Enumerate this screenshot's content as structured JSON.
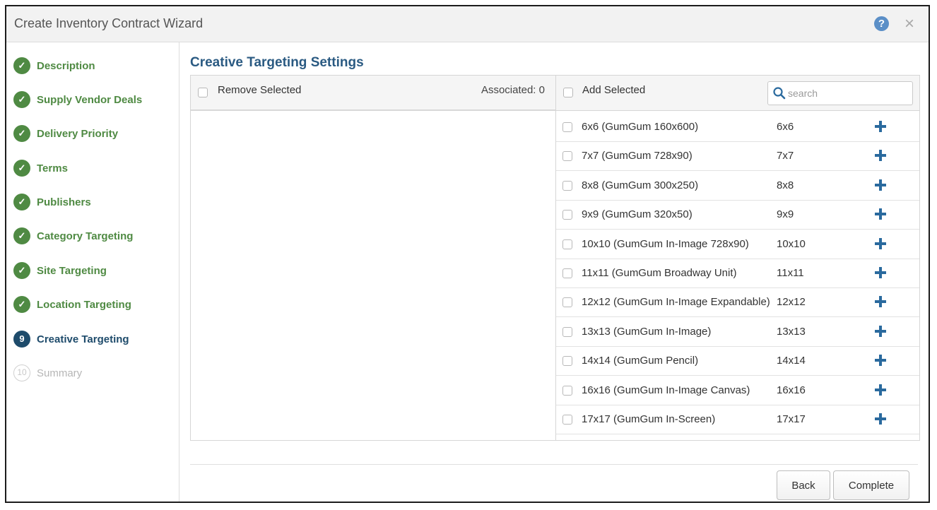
{
  "window": {
    "title": "Create Inventory Contract Wizard"
  },
  "steps": [
    {
      "label": "Description",
      "state": "done"
    },
    {
      "label": "Supply Vendor Deals",
      "state": "done"
    },
    {
      "label": "Delivery Priority",
      "state": "done"
    },
    {
      "label": "Terms",
      "state": "done"
    },
    {
      "label": "Publishers",
      "state": "done"
    },
    {
      "label": "Category Targeting",
      "state": "done"
    },
    {
      "label": "Site Targeting",
      "state": "done"
    },
    {
      "label": "Location Targeting",
      "state": "done"
    },
    {
      "label": "Creative Targeting",
      "state": "active",
      "number": "9"
    },
    {
      "label": "Summary",
      "state": "pending",
      "number": "10"
    }
  ],
  "main": {
    "section_title": "Creative Targeting Settings",
    "left_header": {
      "remove_label": "Remove Selected",
      "associated": "Associated: 0"
    },
    "right_header": {
      "add_label": "Add Selected",
      "search_placeholder": "search",
      "search_value": ""
    },
    "items": [
      {
        "name": "6x6 (GumGum 160x600)",
        "size": "6x6"
      },
      {
        "name": "7x7 (GumGum 728x90)",
        "size": "7x7"
      },
      {
        "name": "8x8 (GumGum 300x250)",
        "size": "8x8"
      },
      {
        "name": "9x9 (GumGum 320x50)",
        "size": "9x9"
      },
      {
        "name": "10x10 (GumGum In-Image 728x90)",
        "size": "10x10"
      },
      {
        "name": "11x11 (GumGum Broadway Unit)",
        "size": "11x11"
      },
      {
        "name": "12x12 (GumGum In-Image Expandable)",
        "size": "12x12"
      },
      {
        "name": "13x13 (GumGum In-Image)",
        "size": "13x13"
      },
      {
        "name": "14x14 (GumGum Pencil)",
        "size": "14x14"
      },
      {
        "name": "16x16 (GumGum In-Image Canvas)",
        "size": "16x16"
      },
      {
        "name": "17x17 (GumGum In-Screen)",
        "size": "17x17"
      }
    ]
  },
  "footer": {
    "back_label": "Back",
    "complete_label": "Complete"
  },
  "icons": {
    "help": "?",
    "close": "×",
    "check": "✓",
    "search": "search-icon",
    "add": "plus-icon"
  },
  "colors": {
    "done": "#4f8a43",
    "active": "#1e4b6b",
    "accent": "#2a6a9e",
    "heading": "#2a5a82"
  }
}
